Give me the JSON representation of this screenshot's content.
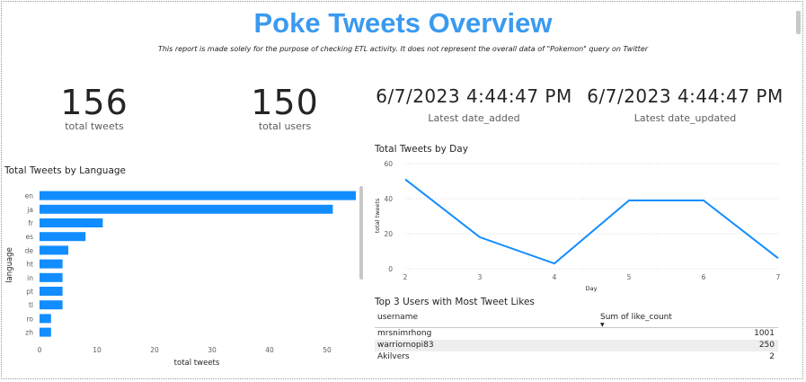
{
  "report": {
    "title": "Poke Tweets Overview",
    "subtitle": "This report is made solely for the purpose of checking ETL activity. It does not represent the overall data of \"Pokemon\" query on Twitter"
  },
  "cards": {
    "total_tweets": {
      "value": "156",
      "label": "total tweets"
    },
    "total_users": {
      "value": "150",
      "label": "total users"
    },
    "latest_added": {
      "value": "6/7/2023 4:44:47 PM",
      "label": "Latest date_added"
    },
    "latest_updated": {
      "value": "6/7/2023 4:44:47 PM",
      "label": "Latest date_updated"
    }
  },
  "language_chart": {
    "title": "Total Tweets by Language",
    "xlabel": "total tweets",
    "ylabel": "language"
  },
  "day_chart": {
    "title": "Total Tweets by Day",
    "xlabel": "Day",
    "ylabel": "total tweets"
  },
  "top_users": {
    "title": "Top 3 Users with Most Tweet Likes",
    "col1": "username",
    "col2": "Sum of like_count",
    "sort_glyph": "▼",
    "rows": [
      {
        "username": "mrsnimrhong",
        "likes": "1001"
      },
      {
        "username": "warriornopi83",
        "likes": "250"
      },
      {
        "username": "Akilvers",
        "likes": "2"
      }
    ]
  },
  "colors": {
    "accent": "#118dff",
    "title": "#3a9af0"
  },
  "chart_data": [
    {
      "type": "bar",
      "orientation": "horizontal",
      "title": "Total Tweets by Language",
      "xlabel": "total tweets",
      "ylabel": "language",
      "categories": [
        "en",
        "ja",
        "fr",
        "es",
        "de",
        "ht",
        "in",
        "pt",
        "tl",
        "ro",
        "zh"
      ],
      "values": [
        55,
        51,
        11,
        8,
        5,
        4,
        4,
        4,
        4,
        2,
        2
      ],
      "xticks": [
        0,
        10,
        20,
        30,
        40,
        50
      ],
      "xlim": [
        0,
        55
      ],
      "grid": false
    },
    {
      "type": "line",
      "title": "Total Tweets by Day",
      "xlabel": "Day",
      "ylabel": "total tweets",
      "x": [
        2,
        3,
        4,
        5,
        6,
        7
      ],
      "values": [
        51,
        18,
        3,
        39,
        39,
        6
      ],
      "yticks": [
        0,
        20,
        40,
        60
      ],
      "ylim": [
        0,
        60
      ],
      "xlim": [
        2,
        7
      ],
      "grid": true
    }
  ]
}
